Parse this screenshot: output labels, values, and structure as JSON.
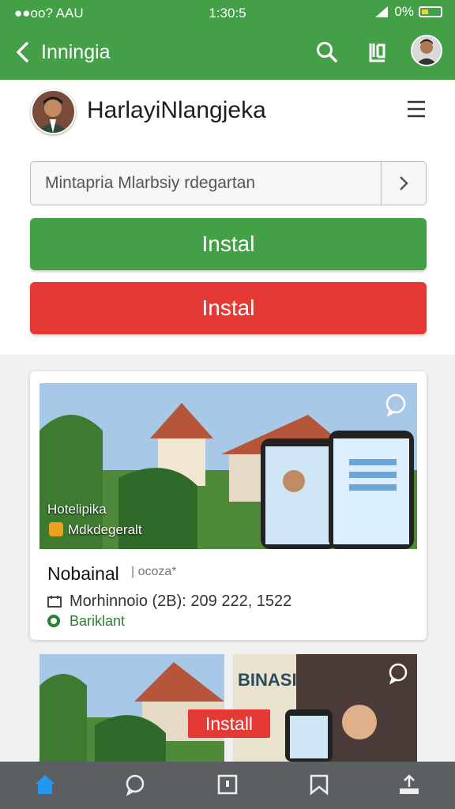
{
  "status_bar": {
    "carrier": "●●oo? AAU",
    "time": "1:30:5",
    "battery": "0%"
  },
  "app_bar": {
    "title": "Inningia",
    "icons": [
      "back-arrow-icon",
      "search-icon",
      "book-icon",
      "avatar"
    ]
  },
  "profile": {
    "name": "HarlayiNlangjeka",
    "menu_icon": "menu-icon"
  },
  "search": {
    "value": "Mintapria  Mlarbsiy rdegartan"
  },
  "buttons": {
    "primary": "Instal",
    "secondary": "Instal"
  },
  "card": {
    "image_caption": "Hotelipika",
    "image_subcaption": "Mdkdegeralt",
    "name": "Nobainal",
    "tag": "| ocoza*",
    "info": "Morhinnoio (2B): 209 222, 1522",
    "status": "Bariklant"
  },
  "tiles": {
    "install_label": "Install",
    "tile2_text": "BINASI"
  },
  "bottom_nav": [
    "home-icon",
    "chat-icon",
    "square-icon",
    "bookmark-icon",
    "upload-icon"
  ],
  "colors": {
    "primary_green": "#43a047",
    "danger_red": "#e53935",
    "nav_bg": "#5c5f62",
    "active_nav": "#2196f3"
  }
}
